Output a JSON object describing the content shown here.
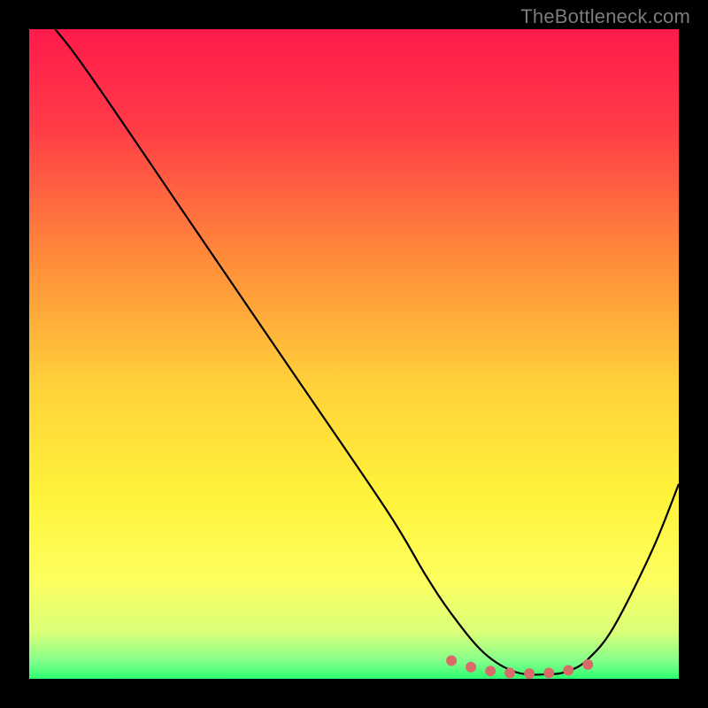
{
  "watermark": "TheBottleneck.com",
  "chart_data": {
    "type": "line",
    "title": "",
    "xlabel": "",
    "ylabel": "",
    "xlim": [
      0,
      100
    ],
    "ylim": [
      0,
      100
    ],
    "gradient_stops": [
      {
        "offset": 0,
        "color": "#ff1a4b"
      },
      {
        "offset": 0.15,
        "color": "#ff3b47"
      },
      {
        "offset": 0.35,
        "color": "#ff8a3a"
      },
      {
        "offset": 0.55,
        "color": "#ffd23a"
      },
      {
        "offset": 0.72,
        "color": "#fff33a"
      },
      {
        "offset": 0.85,
        "color": "#fdff60"
      },
      {
        "offset": 0.93,
        "color": "#d8ff7a"
      },
      {
        "offset": 0.975,
        "color": "#7dff8a"
      },
      {
        "offset": 1.0,
        "color": "#2bff6e"
      }
    ],
    "series": [
      {
        "name": "bottleneck-curve",
        "x": [
          0,
          4,
          10,
          25,
          40,
          55,
          61,
          65,
          70,
          75,
          80,
          83,
          86,
          90,
          96,
          100
        ],
        "values": [
          104,
          100,
          92,
          70,
          48,
          26,
          16,
          10,
          4,
          1,
          0.7,
          1.2,
          3,
          8,
          20,
          30
        ]
      }
    ],
    "markers": {
      "name": "bottom-dots",
      "x": [
        65,
        68,
        71,
        74,
        77,
        80,
        83,
        86
      ],
      "values": [
        2.8,
        1.8,
        1.2,
        0.9,
        0.8,
        0.9,
        1.3,
        2.2
      ],
      "color": "#d86a6a",
      "radius": 6
    }
  }
}
